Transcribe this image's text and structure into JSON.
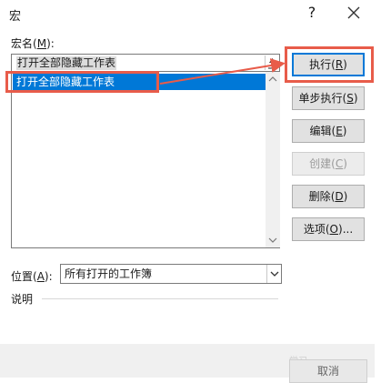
{
  "window": {
    "title": "宏",
    "help_glyph": "?"
  },
  "macro_name": {
    "label": "宏名",
    "label_key": "M",
    "value": "打开全部隐藏工作表"
  },
  "macro_list": {
    "items": [
      {
        "label": "打开全部隐藏工作表",
        "selected": true
      }
    ]
  },
  "buttons": {
    "run": {
      "label": "执行",
      "key": "R",
      "default": true
    },
    "step": {
      "label": "单步执行",
      "key": "S"
    },
    "edit": {
      "label": "编辑",
      "key": "E"
    },
    "create": {
      "label": "创建",
      "key": "C",
      "disabled": true
    },
    "delete": {
      "label": "删除",
      "key": "D"
    },
    "options": {
      "label": "选项",
      "key": "O",
      "suffix": "..."
    },
    "cancel": {
      "label": "取消"
    }
  },
  "location": {
    "label": "位置",
    "label_key": "A",
    "value": "所有打开的工作簿"
  },
  "description": {
    "label": "说明"
  },
  "watermark": {
    "text": "学习"
  },
  "colors": {
    "annotation_red": "#e85c4a",
    "selection_blue": "#0078d7",
    "button_face": "#e1e1e1"
  }
}
